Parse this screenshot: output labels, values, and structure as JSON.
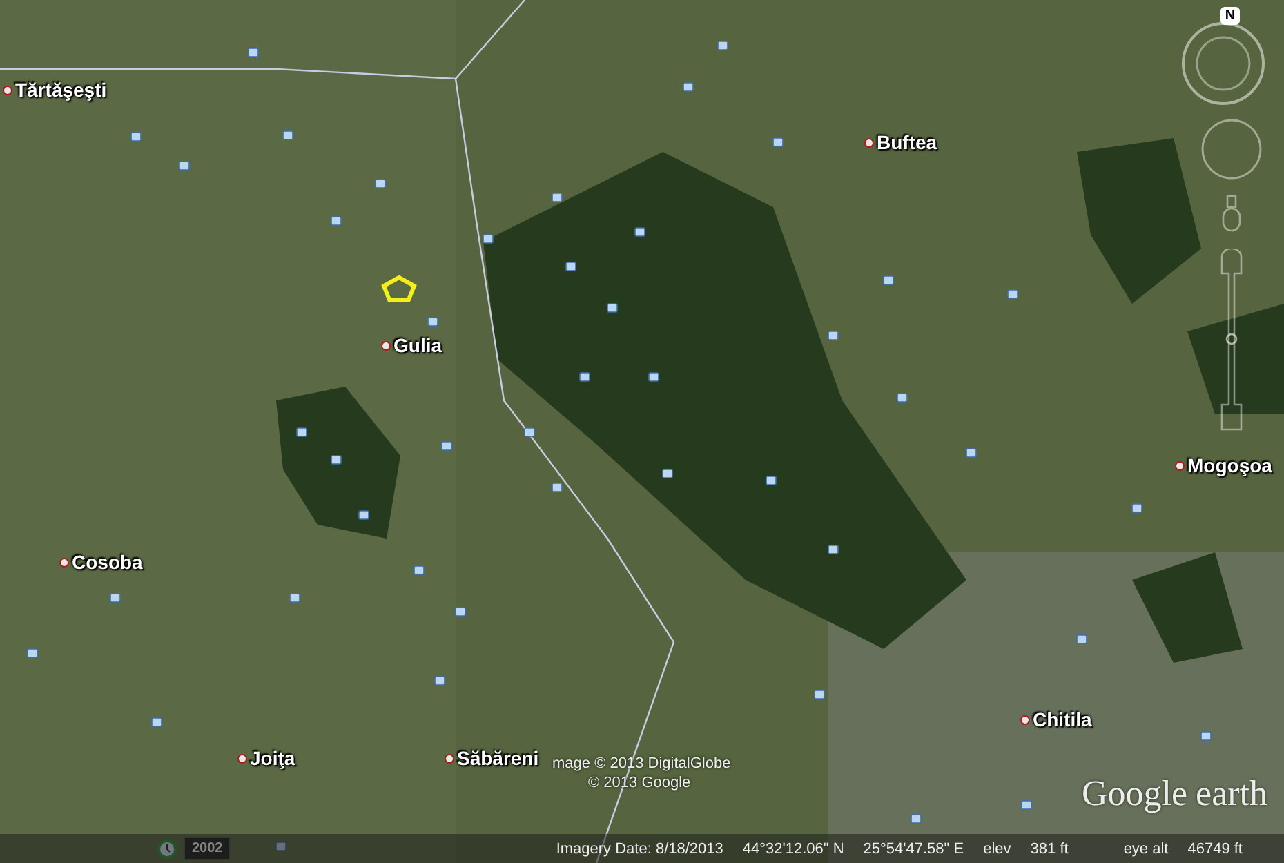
{
  "places": [
    {
      "name": "Tărtăşeşti"
    },
    {
      "name": "Buftea"
    },
    {
      "name": "Gulia"
    },
    {
      "name": "Mogoşoa"
    },
    {
      "name": "Cosoba"
    },
    {
      "name": "Chitila"
    },
    {
      "name": "Joiţa"
    },
    {
      "name": "Săbăreni"
    }
  ],
  "attribution": [
    "mage © 2013 DigitalGlobe",
    "© 2013 Google"
  ],
  "logo": {
    "brand": "Google",
    "product": "earth"
  },
  "navigation": {
    "north": "N",
    "zoom": {
      "level": 0.5
    }
  },
  "time_slider": {
    "year": "2002"
  },
  "status_bar": {
    "imagery_date": "Imagery Date: 8/18/2013",
    "latitude": "44°32'12.06\" N",
    "longitude": "25°54'47.58\" E",
    "elev_label": "elev",
    "elev": "381 ft",
    "eye_alt_label": "eye alt",
    "eye_alt": "46749 ft"
  }
}
